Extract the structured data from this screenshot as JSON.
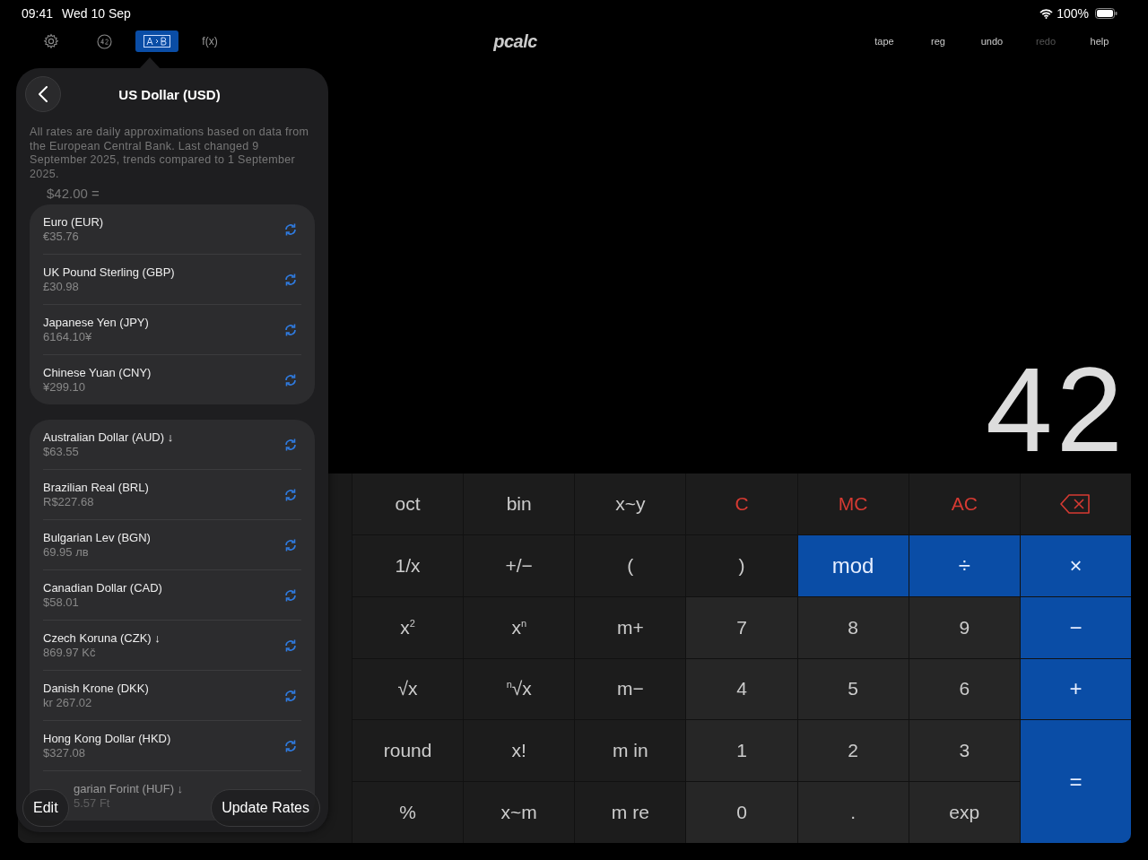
{
  "status_bar": {
    "time": "09:41",
    "date": "Wed 10 Sep",
    "battery": "100%"
  },
  "mode_tabs": [
    {
      "kind": "settings",
      "selected": false
    },
    {
      "kind": "constants",
      "selected": false
    },
    {
      "kind": "conversion",
      "selected": true
    },
    {
      "kind": "functions",
      "label": "f(x)",
      "selected": false
    }
  ],
  "logo": "pcalc",
  "toolbar": [
    {
      "label": "tape",
      "disabled": false
    },
    {
      "label": "reg",
      "disabled": false
    },
    {
      "label": "undo",
      "disabled": false
    },
    {
      "label": "redo",
      "disabled": true
    },
    {
      "label": "help",
      "disabled": false
    }
  ],
  "display": "42",
  "keys": [
    {
      "label": "oct",
      "kind": "fn"
    },
    {
      "label": "bin",
      "kind": "fn"
    },
    {
      "label": "x~y",
      "kind": "fn"
    },
    {
      "label": "C",
      "kind": "clear"
    },
    {
      "label": "MC",
      "kind": "clear"
    },
    {
      "label": "AC",
      "kind": "clear"
    },
    {
      "kind": "backspace"
    },
    {
      "label": "1/x",
      "kind": "fn"
    },
    {
      "label": "+/−",
      "kind": "fn"
    },
    {
      "label": "(",
      "kind": "fn"
    },
    {
      "label": ")",
      "kind": "fn"
    },
    {
      "label": "mod",
      "kind": "op"
    },
    {
      "label": "÷",
      "kind": "op"
    },
    {
      "label": "×",
      "kind": "op"
    },
    {
      "label": "x$^{2}$",
      "kind": "fn"
    },
    {
      "label": "x$^{n}$",
      "kind": "fn"
    },
    {
      "label": "m+",
      "kind": "fn"
    },
    {
      "label": "7",
      "kind": "digit"
    },
    {
      "label": "8",
      "kind": "digit"
    },
    {
      "label": "9",
      "kind": "digit"
    },
    {
      "label": "−",
      "kind": "op"
    },
    {
      "label": "√x",
      "kind": "fn"
    },
    {
      "label": "$^{n}$√x",
      "kind": "fn"
    },
    {
      "label": "m−",
      "kind": "fn"
    },
    {
      "label": "4",
      "kind": "digit"
    },
    {
      "label": "5",
      "kind": "digit"
    },
    {
      "label": "6",
      "kind": "digit"
    },
    {
      "label": "+",
      "kind": "op"
    },
    {
      "label": "round",
      "kind": "fn"
    },
    {
      "label": "x!",
      "kind": "fn"
    },
    {
      "label": "m in",
      "kind": "fn"
    },
    {
      "label": "1",
      "kind": "digit"
    },
    {
      "label": "2",
      "kind": "digit"
    },
    {
      "label": "3",
      "kind": "digit"
    },
    {
      "label": "=",
      "kind": "op",
      "tall": true
    },
    {
      "label": "%",
      "kind": "fn"
    },
    {
      "label": "x~m",
      "kind": "fn"
    },
    {
      "label": "m re",
      "kind": "fn"
    },
    {
      "label": "0",
      "kind": "digit"
    },
    {
      "label": ".",
      "kind": "digit"
    },
    {
      "label": "exp",
      "kind": "digit"
    }
  ],
  "popover": {
    "title": "US Dollar (USD)",
    "note": "All rates are daily approximations based on data from the European Central Bank. Last changed 9 September 2025, trends compared to 1 September 2025.",
    "amount": "$42.00 =",
    "groups": [
      [
        {
          "name": "Euro (EUR)",
          "value": "€35.76"
        },
        {
          "name": "UK Pound Sterling (GBP)",
          "value": "£30.98"
        },
        {
          "name": "Japanese Yen (JPY)",
          "value": "6164.10¥"
        },
        {
          "name": "Chinese Yuan (CNY)",
          "value": "¥299.10"
        }
      ],
      [
        {
          "name": "Australian Dollar (AUD) ↓",
          "value": "$63.55"
        },
        {
          "name": "Brazilian Real (BRL)",
          "value": "R$227.68"
        },
        {
          "name": "Bulgarian Lev (BGN)",
          "value": "69.95 лв"
        },
        {
          "name": "Canadian Dollar (CAD)",
          "value": "$58.01"
        },
        {
          "name": "Czech Koruna (CZK) ↓",
          "value": "869.97 Kč"
        },
        {
          "name": "Danish Krone (DKK)",
          "value": "kr 267.02"
        },
        {
          "name": "Hong Kong Dollar (HKD)",
          "value": "$327.08"
        },
        {
          "name": "garian Forint (HUF) ↓",
          "value": "5.57 Ft",
          "partial": true
        }
      ]
    ],
    "buttons": [
      "Edit",
      "Update Rates"
    ]
  }
}
